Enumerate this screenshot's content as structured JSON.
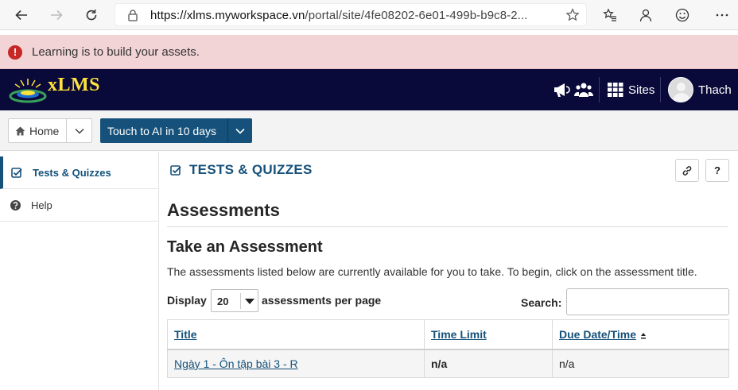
{
  "browser": {
    "url_host": "https://xlms.myworkspace.vn",
    "url_path": "/portal/site/4fe08202-6e01-499b-b9c8-2..."
  },
  "motd": {
    "message": "Learning is to build your assets."
  },
  "header": {
    "logo_text": "xLMS",
    "sites_label": "Sites",
    "user_name": "Thach"
  },
  "site_nav": {
    "home_label": "Home",
    "site_label": "Touch to AI in 10 days"
  },
  "sidebar": {
    "items": [
      {
        "label": "Tests & Quizzes",
        "icon": "check-square-icon",
        "active": true
      },
      {
        "label": "Help",
        "icon": "question-circle-icon",
        "active": false
      }
    ]
  },
  "tool": {
    "title": "TESTS & QUIZZES",
    "help_label": "?"
  },
  "main": {
    "heading": "Assessments",
    "subheading": "Take an Assessment",
    "instructions": "The assessments listed below are currently available for you to take. To begin, click on the assessment title.",
    "display_label": "Display",
    "page_size": "20",
    "per_page_label": "assessments per page",
    "search_label": "Search:",
    "search_value": ""
  },
  "table": {
    "columns": [
      "Title",
      "Time Limit",
      "Due Date/Time"
    ],
    "rows": [
      {
        "title": "Ngày 1 - Ôn tập bài 3 - R",
        "time_limit": "n/a",
        "due": "n/a"
      }
    ]
  },
  "colors": {
    "brand_dark": "#0a0a3a",
    "accent": "#15517a",
    "logo_yellow": "#ffe23a",
    "banner_bg": "#f2d4d6"
  }
}
